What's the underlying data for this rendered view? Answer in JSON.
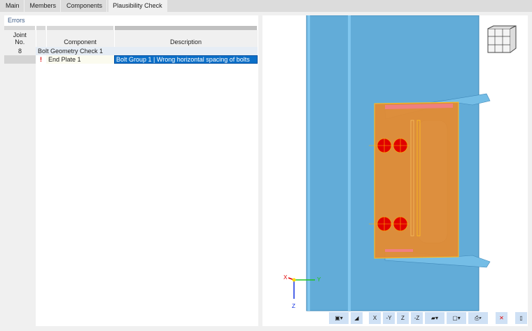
{
  "tabs": [
    {
      "label": "Main"
    },
    {
      "label": "Members"
    },
    {
      "label": "Components"
    },
    {
      "label": "Plausibility Check"
    }
  ],
  "panel_title": "Errors",
  "table": {
    "headers": {
      "joint": "Joint\nNo.",
      "component": "Component",
      "description": "Description"
    },
    "group": {
      "joint": "8",
      "label": "Bolt Geometry Check 1"
    },
    "rows": [
      {
        "icon": "error-icon",
        "component": "End Plate 1",
        "description": "Bolt Group 1 | Wrong horizontal spacing of bolts"
      }
    ]
  },
  "axes": {
    "x": "X",
    "y": "Y",
    "z": "Z"
  },
  "toolbar": {
    "buttons": [
      "view-options",
      "render-options",
      "view-x",
      "view-neg-y",
      "view-z",
      "view-iso-z",
      "display-mode",
      "wireframe",
      "print",
      "clear-errors",
      "export"
    ]
  },
  "colors": {
    "steel": "#62acd8",
    "plate": "#e68a2e",
    "bolt": "#e00000",
    "selection": "#0a6fc8"
  }
}
